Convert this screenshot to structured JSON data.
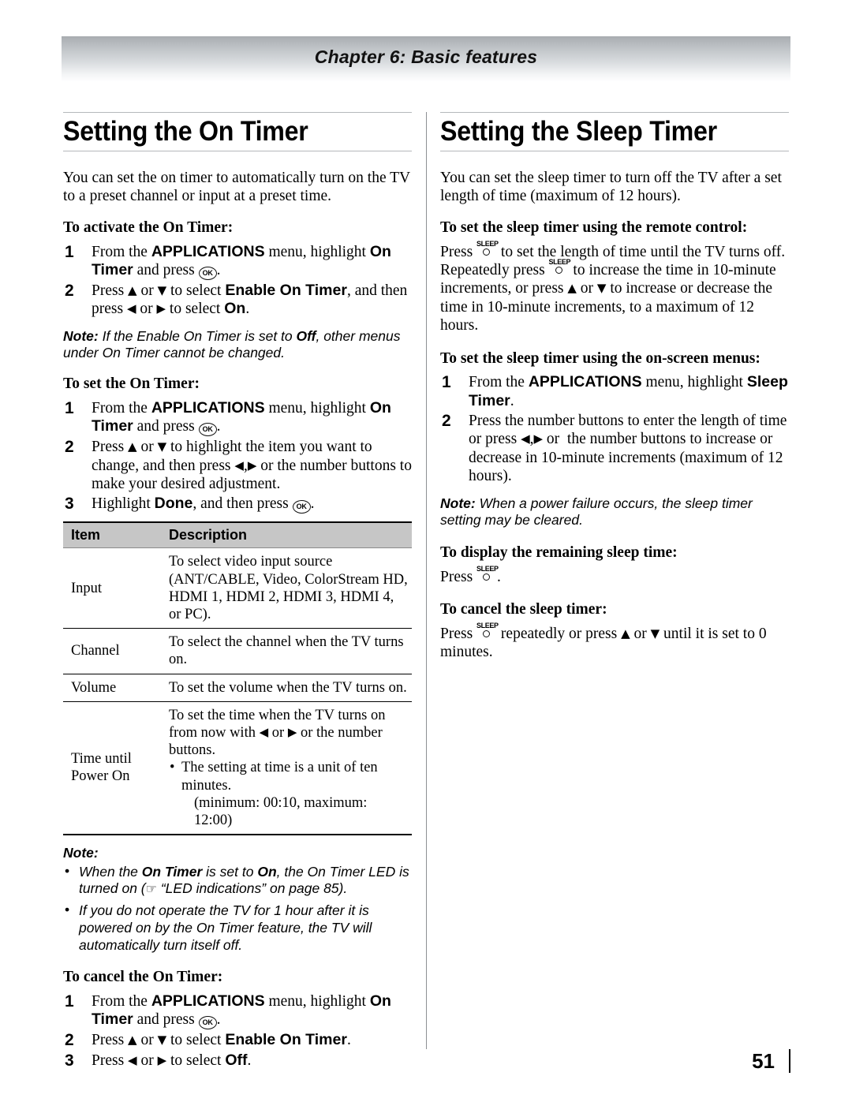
{
  "header": {
    "chapter_title": "Chapter 6: Basic features"
  },
  "footer": {
    "page_number": "51"
  },
  "left_column": {
    "heading": "Setting the On Timer",
    "intro": "You can set the on timer to automatically turn on the TV to a preset channel or input at a preset time.",
    "activate_heading": "To activate the On Timer:",
    "activate_steps": [
      {
        "num": "1",
        "text": "From the APPLICATIONS menu, highlight On Timer and press OK."
      },
      {
        "num": "2",
        "text": "Press ▲ or ▼ to select Enable On Timer, and then press ◀ or ▶ to select On."
      }
    ],
    "note_enable": {
      "label": "Note:",
      "text": "If the Enable On Timer is set to Off, other menus under On Timer cannot be changed."
    },
    "set_heading": "To set the On Timer:",
    "set_steps": [
      {
        "num": "1",
        "text": "From the APPLICATIONS menu, highlight On Timer and press OK."
      },
      {
        "num": "2",
        "text": "Press ▲ or ▼ to highlight the item you want to change, and then press ◀, ▶ or the number buttons to make your desired adjustment."
      },
      {
        "num": "3",
        "text": "Highlight Done, and then press OK."
      }
    ],
    "table": {
      "headers": [
        "Item",
        "Description"
      ],
      "rows": [
        {
          "item": "Input",
          "description": "To select video input source (ANT/CABLE, Video, ColorStream HD, HDMI 1, HDMI 2, HDMI 3, HDMI 4, or PC)."
        },
        {
          "item": "Channel",
          "description": "To select the channel when the TV turns on."
        },
        {
          "item": "Volume",
          "description": "To set the volume when the TV turns on."
        },
        {
          "item": "Time until Power On",
          "description_line1": "To set the time when the TV turns on from now with ◀ or ▶ or the number buttons.",
          "description_bullet": "The setting at time is a unit of ten minutes.",
          "description_bullet_sub": "(minimum: 00:10, maximum: 12:00)"
        }
      ]
    },
    "note_block": {
      "label": "Note:",
      "bullets": [
        "When the On Timer is set to On, the On Timer LED is turned on (☞ “LED indications” on page 85).",
        "If you do not operate the TV for 1 hour after it is powered on by the On Timer feature, the TV will automatically turn itself off."
      ]
    },
    "cancel_heading": "To cancel the On Timer:",
    "cancel_steps": [
      {
        "num": "1",
        "text": "From the APPLICATIONS menu, highlight On Timer and press OK."
      },
      {
        "num": "2",
        "text": "Press ▲ or ▼ to select Enable On Timer."
      },
      {
        "num": "3",
        "text": "Press ◀ or ▶ to select Off."
      }
    ]
  },
  "right_column": {
    "heading": "Setting the Sleep Timer",
    "intro": "You can set the sleep timer to turn off the TV after a set length of time (maximum of 12 hours).",
    "remote_heading": "To set the sleep timer using the remote control:",
    "remote_text": "Press SLEEP to set the length of time until the TV turns off. Repeatedly press SLEEP to increase the time in 10-minute increments, or press ▲ or ▼ to increase or decrease the time in 10-minute increments, to a maximum of 12 hours.",
    "menus_heading": "To set the sleep timer using the on-screen menus:",
    "menus_steps": [
      {
        "num": "1",
        "text": "From the APPLICATIONS menu, highlight Sleep Timer."
      },
      {
        "num": "2",
        "text": "Press the number buttons to enter the length of time or press ◀, ▶ or  the number buttons to increase or decrease in 10-minute increments (maximum of 12 hours)."
      }
    ],
    "note_power": {
      "label": "Note:",
      "text": "When a power failure occurs, the sleep timer setting may be cleared."
    },
    "display_heading": "To display the remaining sleep time:",
    "display_text": "Press SLEEP.",
    "cancel_heading": "To cancel the sleep timer:",
    "cancel_text": "Press SLEEP repeatedly or press ▲ or ▼ until it is set to 0 minutes.",
    "sleep_key_label": "SLEEP",
    "ok_key_label": "OK"
  }
}
